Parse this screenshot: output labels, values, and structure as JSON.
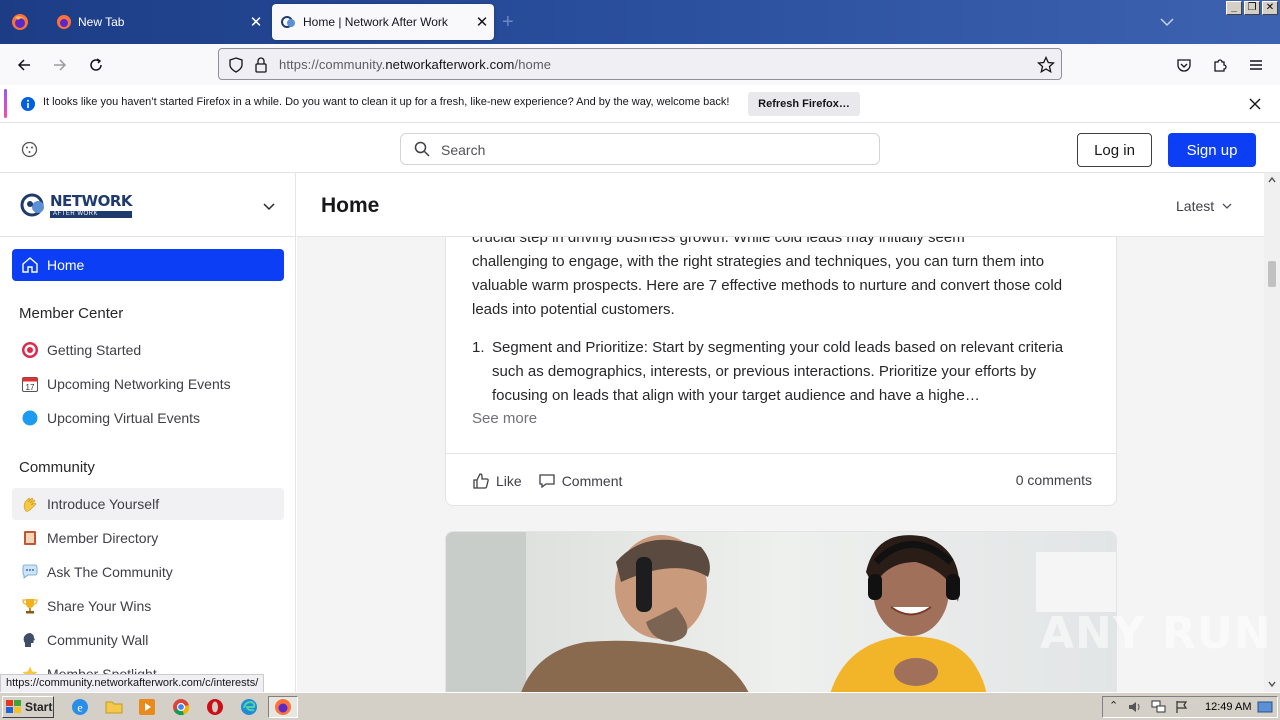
{
  "browser": {
    "tabs": [
      {
        "title": "New Tab",
        "active": false
      },
      {
        "title": "Home | Network After Work",
        "active": true
      }
    ],
    "url_prefix": "https://community.",
    "url_domain": "networkafterwork.com",
    "url_path": "/home",
    "status_url": "https://community.networkafterwork.com/c/interests/"
  },
  "notification": {
    "text": "It looks like you haven’t started Firefox in a while. Do you want to clean it up for a fresh, like-new experience? And by the way, welcome back!",
    "button": "Refresh Firefox…"
  },
  "header": {
    "search_placeholder": "Search",
    "login": "Log in",
    "signup": "Sign up"
  },
  "sidebar": {
    "logo_main": "NETWORK",
    "logo_sub": "AFTER WORK",
    "home": "Home",
    "sections": [
      {
        "title": "Member Center",
        "items": [
          {
            "label": "Getting Started",
            "icon": "target-icon"
          },
          {
            "label": "Upcoming Networking Events",
            "icon": "calendar-icon"
          },
          {
            "label": "Upcoming Virtual Events",
            "icon": "blue-circle-icon"
          }
        ]
      },
      {
        "title": "Community",
        "items": [
          {
            "label": "Introduce Yourself",
            "icon": "waving-hand-icon"
          },
          {
            "label": "Member Directory",
            "icon": "book-icon"
          },
          {
            "label": "Ask The Community",
            "icon": "speech-bubble-icon"
          },
          {
            "label": "Share Your Wins",
            "icon": "trophy-icon"
          },
          {
            "label": "Community Wall",
            "icon": "speaking-head-icon"
          },
          {
            "label": "Member Spotlight",
            "icon": "star-icon"
          }
        ]
      }
    ]
  },
  "main": {
    "title": "Home",
    "sort": "Latest",
    "post": {
      "partial_line": "crucial step in driving business growth. While cold leads may initially seem",
      "paragraph": "challenging to engage, with the right strategies and techniques, you can turn them into valuable warm prospects. Here are 7 effective methods to nurture and convert those cold leads into potential customers.",
      "list_number": "1.",
      "list_text": "Segment and Prioritize: Start by segmenting your cold leads based on relevant criteria such as demographics, interests, or previous interactions. Prioritize your efforts by focusing on leads that align with your target audience and have a highe…",
      "see_more": "See more",
      "like": "Like",
      "comment": "Comment",
      "comments_count": "0 comments"
    }
  },
  "taskbar": {
    "start": "Start",
    "clock": "12:49 AM"
  },
  "watermark": "ANY RUN"
}
